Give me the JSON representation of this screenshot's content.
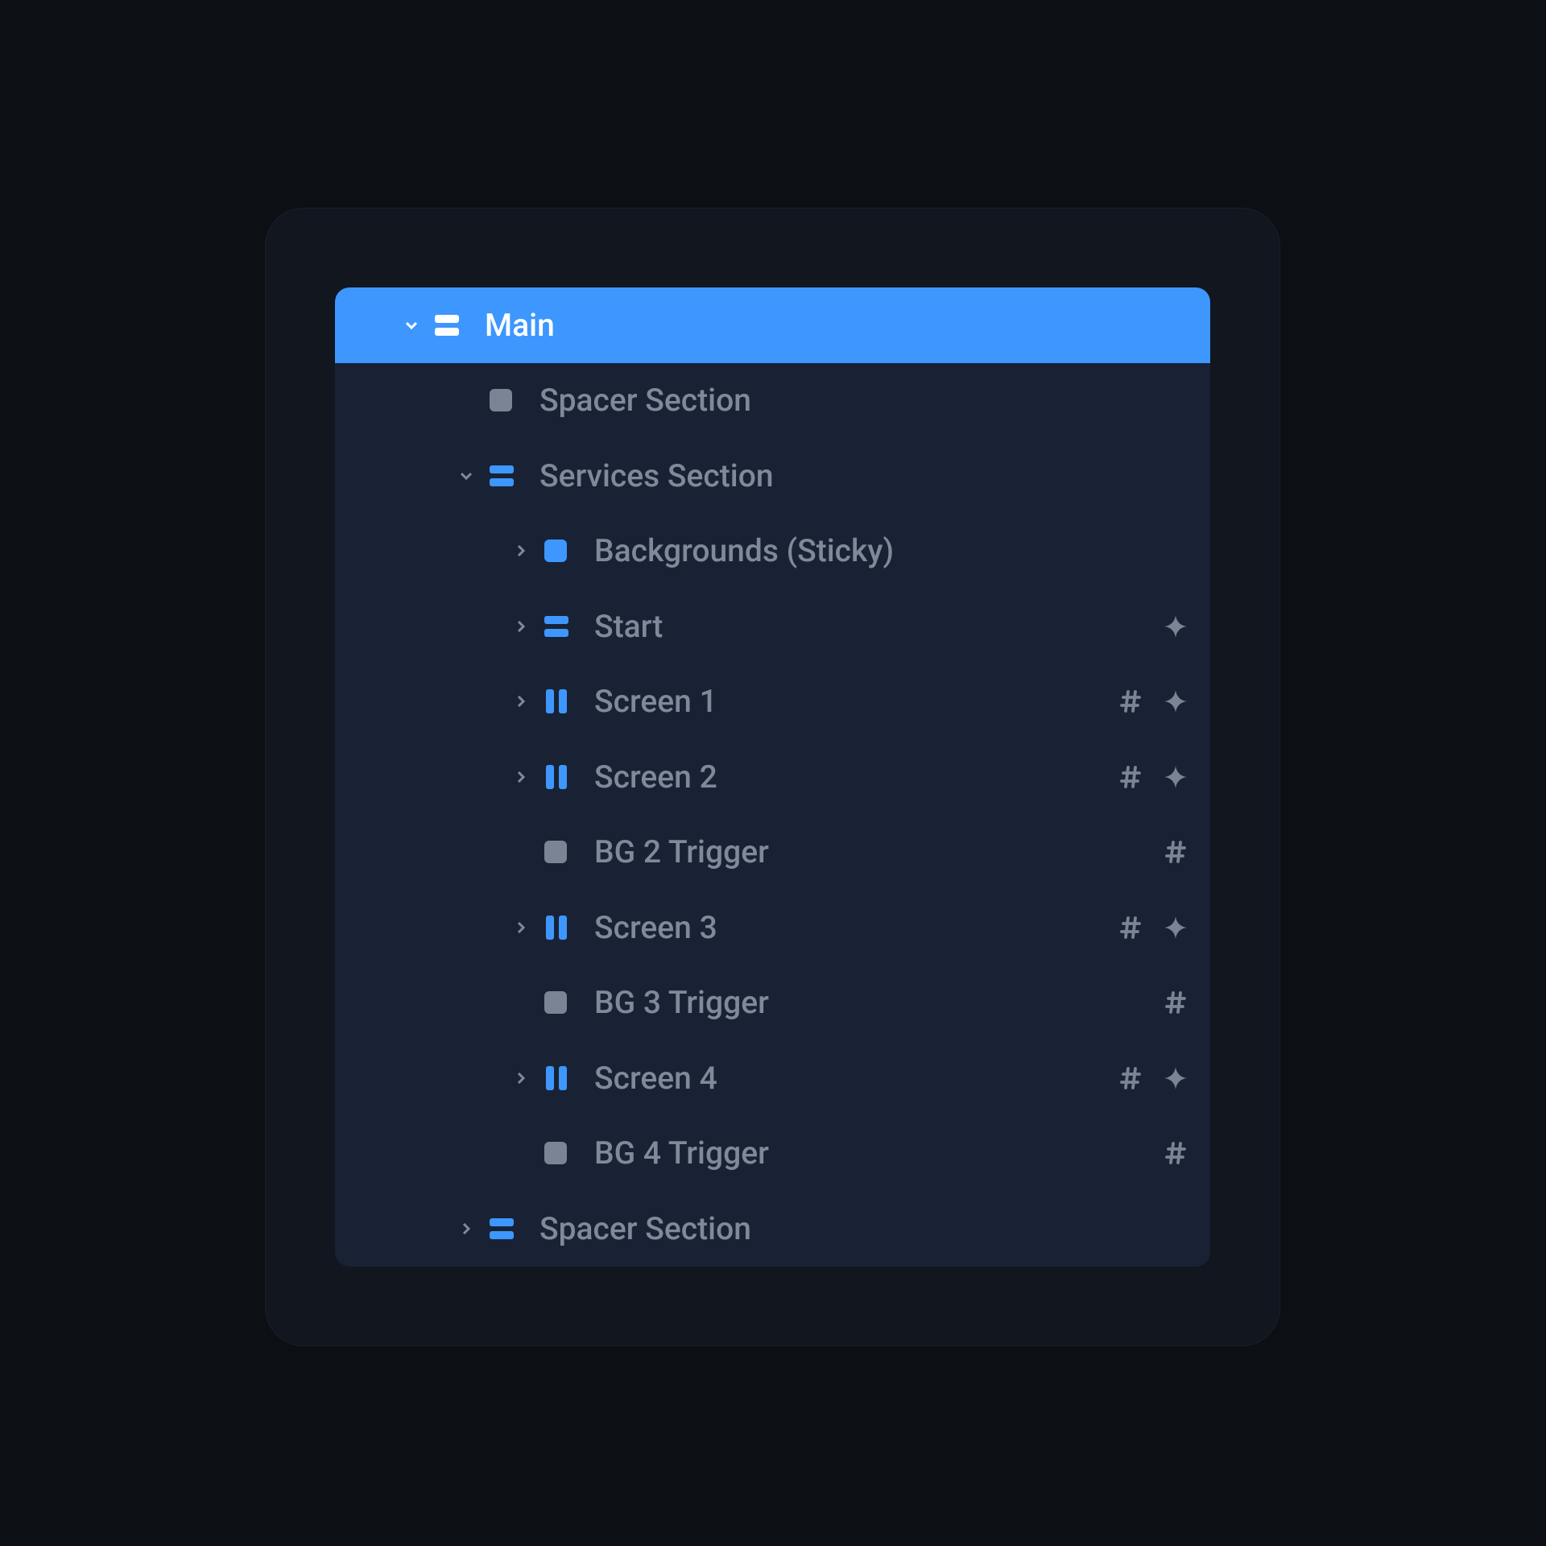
{
  "tree": {
    "root": {
      "label": "Main",
      "icon": "section",
      "expanded": true,
      "selected": true
    },
    "items": [
      {
        "label": "Spacer Section",
        "icon": "block",
        "indent": 1,
        "chevron": null,
        "badges": []
      },
      {
        "label": "Services Section",
        "icon": "section",
        "indent": 1,
        "chevron": "down",
        "badges": []
      },
      {
        "label": "Backgrounds (Sticky)",
        "icon": "block-b",
        "indent": 2,
        "chevron": "right",
        "badges": []
      },
      {
        "label": "Start",
        "icon": "section",
        "indent": 2,
        "chevron": "right",
        "badges": [
          "sparkle"
        ]
      },
      {
        "label": "Screen 1",
        "icon": "columns",
        "indent": 2,
        "chevron": "right",
        "badges": [
          "hash",
          "sparkle"
        ]
      },
      {
        "label": "Screen 2",
        "icon": "columns",
        "indent": 2,
        "chevron": "right",
        "badges": [
          "hash",
          "sparkle"
        ]
      },
      {
        "label": "BG 2 Trigger",
        "icon": "block",
        "indent": 2,
        "chevron": null,
        "badges": [
          "hash"
        ]
      },
      {
        "label": "Screen 3",
        "icon": "columns",
        "indent": 2,
        "chevron": "right",
        "badges": [
          "hash",
          "sparkle"
        ]
      },
      {
        "label": "BG 3 Trigger",
        "icon": "block",
        "indent": 2,
        "chevron": null,
        "badges": [
          "hash"
        ]
      },
      {
        "label": "Screen 4",
        "icon": "columns",
        "indent": 2,
        "chevron": "right",
        "badges": [
          "hash",
          "sparkle"
        ]
      },
      {
        "label": "BG 4 Trigger",
        "icon": "block",
        "indent": 2,
        "chevron": null,
        "badges": [
          "hash"
        ]
      },
      {
        "label": "Spacer Section",
        "icon": "section",
        "indent": 1,
        "chevron": "right",
        "badges": []
      }
    ]
  },
  "colors": {
    "accent": "#3d97fe",
    "iconBlue": "#3d97fe",
    "iconMuted": "#7b8494"
  }
}
